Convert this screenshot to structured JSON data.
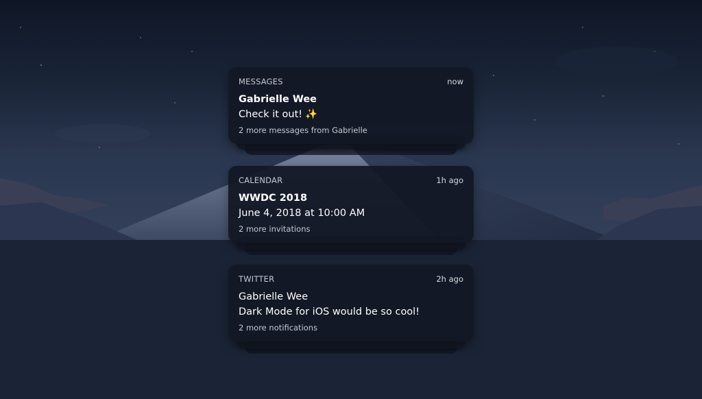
{
  "notifications": [
    {
      "app": "MESSAGES",
      "time": "now",
      "title": "Gabrielle Wee",
      "body": "Check it out!",
      "emoji": "✨",
      "more": "2 more messages from Gabrielle"
    },
    {
      "app": "CALENDAR",
      "time": "1h ago",
      "title": "WWDC 2018",
      "body": "June 4, 2018 at 10:00 AM",
      "more": "2 more invitations"
    },
    {
      "app": "TWITTER",
      "time": "2h ago",
      "title": "Gabrielle Wee",
      "body": "Dark Mode for iOS would be so cool!",
      "more": "2 more notifications"
    }
  ],
  "icons": {
    "sparkle": "sparkles-emoji"
  },
  "colors": {
    "card_bg": "#121724",
    "sky_top": "#0f1626",
    "ground": "#1b2436"
  }
}
